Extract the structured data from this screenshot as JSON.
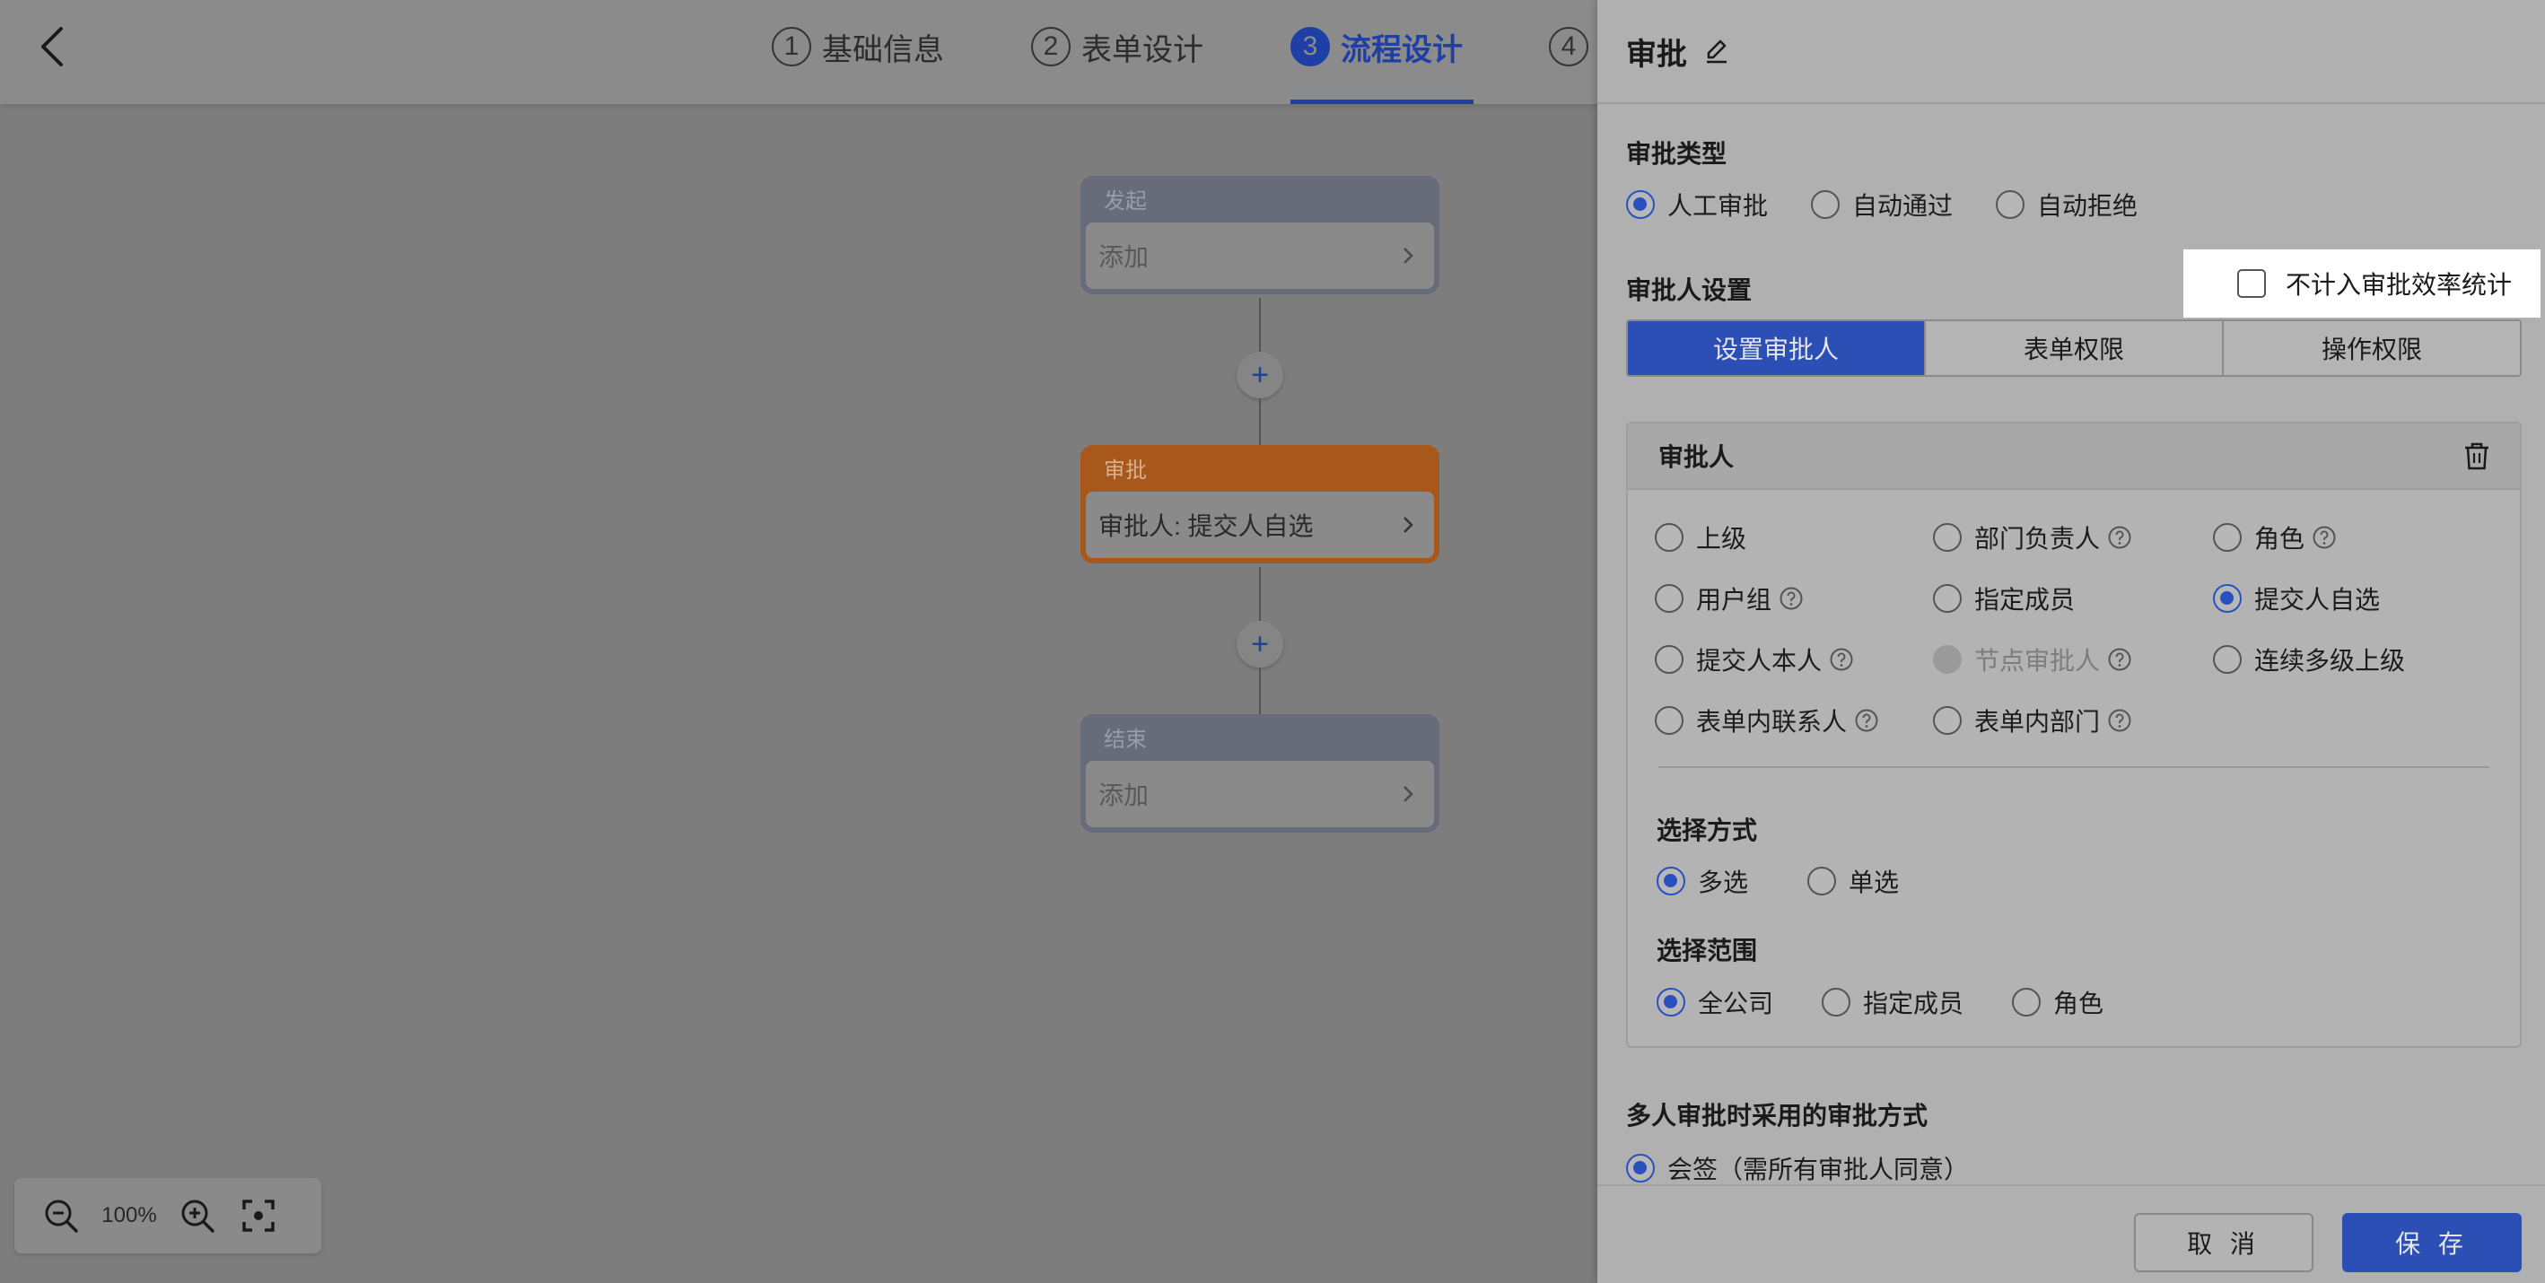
{
  "steps": [
    {
      "num": "1",
      "label": "基础信息"
    },
    {
      "num": "2",
      "label": "表单设计"
    },
    {
      "num": "3",
      "label": "流程设计"
    },
    {
      "num": "4",
      "label": ""
    }
  ],
  "flow": {
    "start": {
      "title": "发起",
      "body": "添加"
    },
    "approve": {
      "title": "审批",
      "body": "审批人: 提交人自选"
    },
    "end": {
      "title": "结束",
      "body": "添加"
    },
    "add_symbol": "+"
  },
  "zoom": {
    "value": "100%"
  },
  "panel": {
    "title": "审批",
    "approval_type": {
      "label": "审批类型",
      "options": [
        "人工审批",
        "自动通过",
        "自动拒绝"
      ],
      "selected": "人工审批"
    },
    "approver_settings": {
      "label": "审批人设置",
      "exclude_checkbox": "不计入审批效率统计",
      "tabs": [
        "设置审批人",
        "表单权限",
        "操作权限"
      ],
      "active_tab": "设置审批人"
    },
    "approver_card": {
      "title": "审批人",
      "options": [
        [
          "上级",
          "部门负责人",
          "角色"
        ],
        [
          "用户组",
          "指定成员",
          "提交人自选"
        ],
        [
          "提交人本人",
          "节点审批人",
          "连续多级上级"
        ],
        [
          "表单内联系人",
          "表单内部门"
        ]
      ],
      "selected": "提交人自选",
      "disabled": "节点审批人",
      "select_mode": {
        "label": "选择方式",
        "options": [
          "多选",
          "单选"
        ],
        "selected": "多选"
      },
      "select_scope": {
        "label": "选择范围",
        "options": [
          "全公司",
          "指定成员",
          "角色"
        ],
        "selected": "全公司"
      }
    },
    "multi_approve": {
      "label": "多人审批时采用的审批方式",
      "option": "会签（需所有审批人同意）"
    },
    "footer": {
      "cancel": "取 消",
      "save": "保 存"
    }
  },
  "colors": {
    "accent": "#2b4fb5",
    "orange_node": "#a7581a",
    "highlight": "#ffffff"
  }
}
